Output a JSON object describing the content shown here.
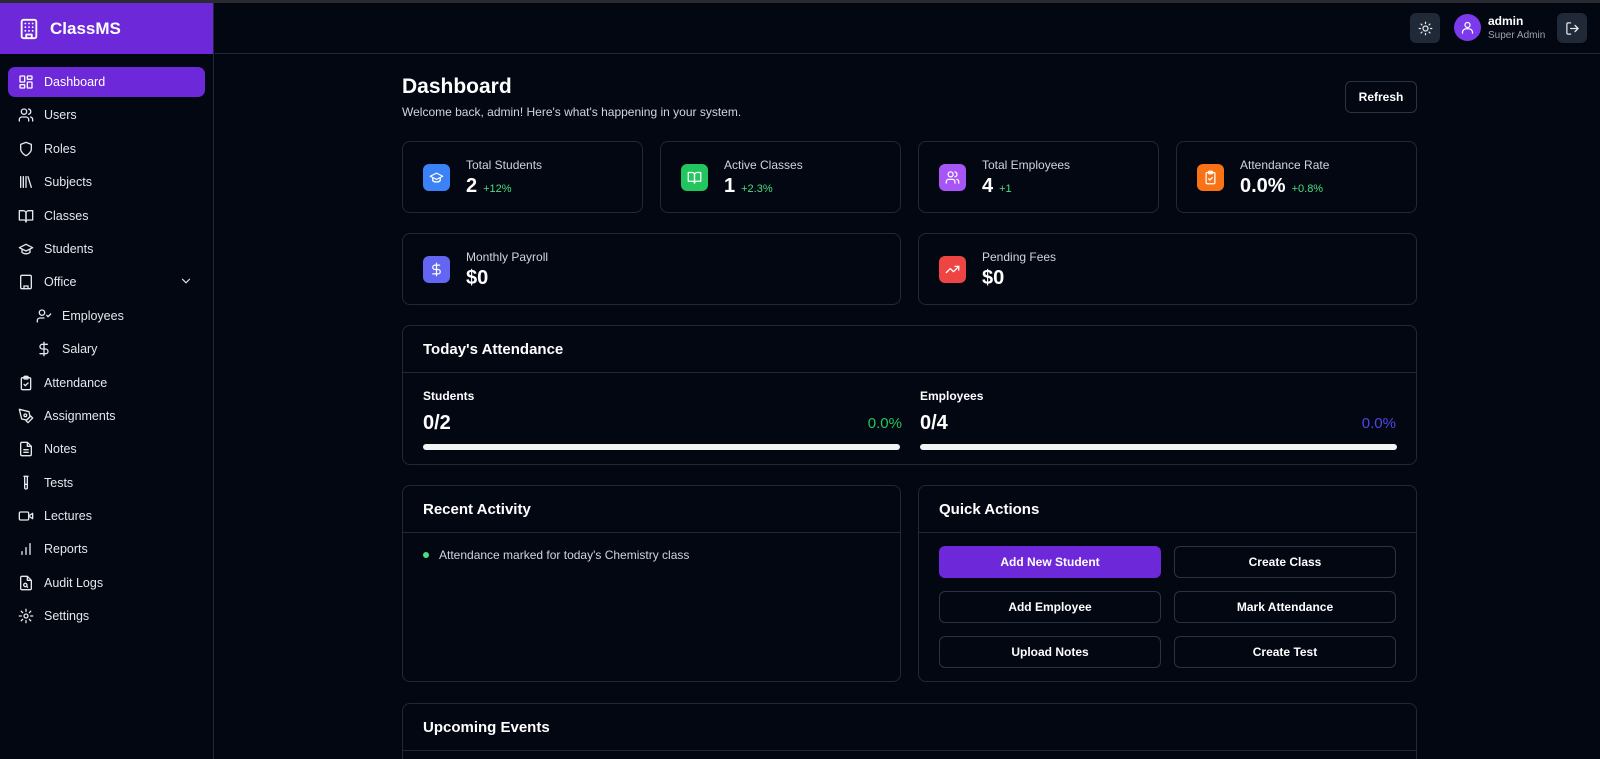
{
  "app": {
    "name": "ClassMS",
    "brand_color": "#6d28d9"
  },
  "sidebar": {
    "items": [
      {
        "label": "Dashboard",
        "icon": "dashboard-icon",
        "active": true
      },
      {
        "label": "Users",
        "icon": "users-icon"
      },
      {
        "label": "Roles",
        "icon": "shield-icon"
      },
      {
        "label": "Subjects",
        "icon": "library-icon"
      },
      {
        "label": "Classes",
        "icon": "book-open-icon"
      },
      {
        "label": "Students",
        "icon": "graduation-cap-icon"
      },
      {
        "label": "Office",
        "icon": "building-icon",
        "expanded": true
      },
      {
        "label": "Employees",
        "icon": "user-check-icon",
        "sub": true
      },
      {
        "label": "Salary",
        "icon": "dollar-icon",
        "sub": true
      },
      {
        "label": "Attendance",
        "icon": "clipboard-check-icon"
      },
      {
        "label": "Assignments",
        "icon": "pen-tool-icon"
      },
      {
        "label": "Notes",
        "icon": "file-text-icon"
      },
      {
        "label": "Tests",
        "icon": "test-tube-icon"
      },
      {
        "label": "Lectures",
        "icon": "video-icon"
      },
      {
        "label": "Reports",
        "icon": "bar-chart-icon"
      },
      {
        "label": "Audit Logs",
        "icon": "file-search-icon"
      },
      {
        "label": "Settings",
        "icon": "gear-icon"
      }
    ]
  },
  "header": {
    "user_name": "admin",
    "user_role": "Super Admin"
  },
  "page": {
    "title": "Dashboard",
    "subtitle": "Welcome back, admin! Here's what's happening in your system.",
    "refresh_label": "Refresh"
  },
  "stats": [
    {
      "label": "Total Students",
      "value": "2",
      "change": "+12%",
      "color": "#3b82f6",
      "icon": "graduation-cap-icon"
    },
    {
      "label": "Active Classes",
      "value": "1",
      "change": "+2.3%",
      "color": "#22c55e",
      "icon": "book-open-icon"
    },
    {
      "label": "Total Employees",
      "value": "4",
      "change": "+1",
      "color": "#a855f7",
      "icon": "users-icon"
    },
    {
      "label": "Attendance Rate",
      "value": "0.0%",
      "change": "+0.8%",
      "color": "#f97316",
      "icon": "clipboard-check-icon"
    },
    {
      "label": "Monthly Payroll",
      "value": "$0",
      "change": "",
      "color": "#6366f1",
      "icon": "dollar-icon"
    },
    {
      "label": "Pending Fees",
      "value": "$0",
      "change": "",
      "color": "#ef4444",
      "icon": "trending-up-icon"
    }
  ],
  "attendance": {
    "title": "Today's Attendance",
    "students": {
      "label": "Students",
      "count": "0/2",
      "percent": "0.0%",
      "fraction": 0,
      "color": "#22c55e"
    },
    "employees": {
      "label": "Employees",
      "count": "0/4",
      "percent": "0.0%",
      "fraction": 0,
      "color": "#4f46e5"
    }
  },
  "recent_activity": {
    "title": "Recent Activity",
    "items": [
      "Attendance marked for today's Chemistry class"
    ]
  },
  "quick_actions": {
    "title": "Quick Actions",
    "buttons": [
      "Add New Student",
      "Create Class",
      "Add Employee",
      "Mark Attendance",
      "Upload Notes",
      "Create Test"
    ]
  },
  "upcoming_events": {
    "title": "Upcoming Events"
  }
}
